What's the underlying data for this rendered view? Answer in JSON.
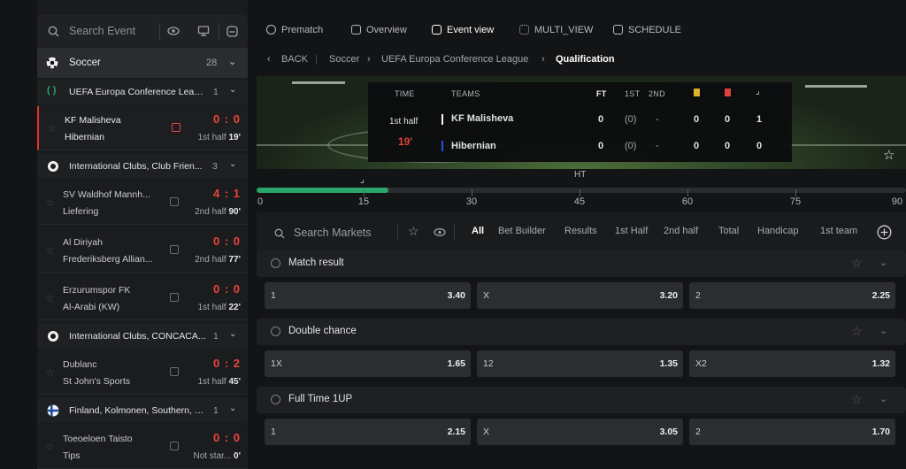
{
  "sidebar": {
    "search_placeholder": "Search Event",
    "sport": {
      "name": "Soccer",
      "count": "28"
    },
    "groups": [
      {
        "league": "UEFA Europa Conference Leagu...",
        "count": "1",
        "matches": [
          {
            "home": "KF Malisheva",
            "away": "Hibernian",
            "score": "0 : 0",
            "period": "1st half",
            "minute": "19'"
          }
        ]
      },
      {
        "league": "International Clubs, Club Frien...",
        "count": "3",
        "matches": [
          {
            "home": "SV Waldhof Mannh...",
            "away": "Liefering",
            "score": "4 : 1",
            "period": "2nd half",
            "minute": "90'"
          },
          {
            "home": "Al Diriyah",
            "away": "Frederiksberg Allian...",
            "score": "0 : 0",
            "period": "2nd half",
            "minute": "77'"
          },
          {
            "home": "Erzurumspor FK",
            "away": "Al-Arabi (KW)",
            "score": "0 : 0",
            "period": "1st half",
            "minute": "22'"
          }
        ]
      },
      {
        "league": "International Clubs, CONCACA...",
        "count": "1",
        "matches": [
          {
            "home": "Dublanc",
            "away": "St John's Sports",
            "score": "0 : 2",
            "period": "1st half",
            "minute": "45'"
          }
        ]
      },
      {
        "league": "Finland, Kolmonen, Southern, G...",
        "count": "1",
        "matches": [
          {
            "home": "Toeoeloen Taisto",
            "away": "Tips",
            "score": "0 : 0",
            "period": "Not star...",
            "minute": "0'"
          }
        ]
      }
    ]
  },
  "nav": {
    "tabs": [
      "Prematch",
      "Overview",
      "Event view",
      "MULTI_VIEW",
      "SCHEDULE"
    ],
    "active": "Event view"
  },
  "breadcrumb": {
    "back": "BACK",
    "items": [
      "Soccer",
      "UEFA Europa Conference League",
      "Qualification"
    ]
  },
  "scoreboard": {
    "headers": {
      "time": "TIME",
      "teams": "TEAMS",
      "ft": "FT",
      "first": "1ST",
      "second": "2ND"
    },
    "period": "1st half",
    "minute": "19'",
    "rows": [
      {
        "team": "KF Malisheva",
        "ft": "0",
        "first": "(0)",
        "second": "-",
        "yellow": "0",
        "red": "0",
        "corners": "1",
        "color": "#ffffff"
      },
      {
        "team": "Hibernian",
        "ft": "0",
        "first": "(0)",
        "second": "-",
        "yellow": "0",
        "red": "0",
        "corners": "0",
        "color": "#2b4de0"
      }
    ]
  },
  "timeline": {
    "ht_label": "HT",
    "ticks": [
      "0",
      "15",
      "30",
      "45",
      "60",
      "75",
      "90"
    ],
    "progress_minute": 19,
    "max_minute": 90
  },
  "markets_bar": {
    "search_placeholder": "Search Markets",
    "tabs": [
      "All",
      "Bet Builder",
      "Results",
      "1st Half",
      "2nd half",
      "Total",
      "Handicap",
      "1st team"
    ],
    "active": "All"
  },
  "markets": [
    {
      "title": "Match result",
      "odds": [
        {
          "label": "1",
          "value": "3.40"
        },
        {
          "label": "X",
          "value": "3.20"
        },
        {
          "label": "2",
          "value": "2.25"
        }
      ]
    },
    {
      "title": "Double chance",
      "odds": [
        {
          "label": "1X",
          "value": "1.65"
        },
        {
          "label": "12",
          "value": "1.35"
        },
        {
          "label": "X2",
          "value": "1.32"
        }
      ]
    },
    {
      "title": "Full Time 1UP",
      "odds": [
        {
          "label": "1",
          "value": "2.15"
        },
        {
          "label": "X",
          "value": "3.05"
        },
        {
          "label": "2",
          "value": "1.70"
        }
      ]
    }
  ],
  "colors": {
    "accent_red": "#e8453c",
    "progress_green": "#2aa56b"
  }
}
